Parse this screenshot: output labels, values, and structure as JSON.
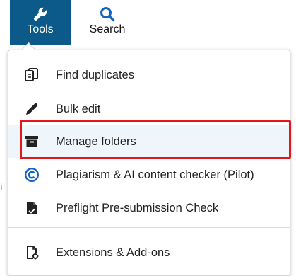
{
  "toolbar": {
    "tools_label": "Tools",
    "search_label": "Search",
    "tools_bg": "#0b5a8a"
  },
  "menu": {
    "items": [
      {
        "label": "Find duplicates",
        "icon": "duplicate-icon"
      },
      {
        "label": "Bulk edit",
        "icon": "pencil-icon"
      },
      {
        "label": "Manage folders",
        "icon": "archive-box-icon",
        "highlighted": true
      },
      {
        "label": "Plagiarism & AI content checker (Pilot)",
        "icon": "copyright-circle-icon"
      },
      {
        "label": "Preflight Pre-submission Check",
        "icon": "document-check-icon"
      },
      {
        "label": "Extensions & Add-ons",
        "icon": "document-gear-icon"
      }
    ],
    "highlight_color": "#e3161b"
  },
  "background": {
    "partial_text": "i"
  }
}
